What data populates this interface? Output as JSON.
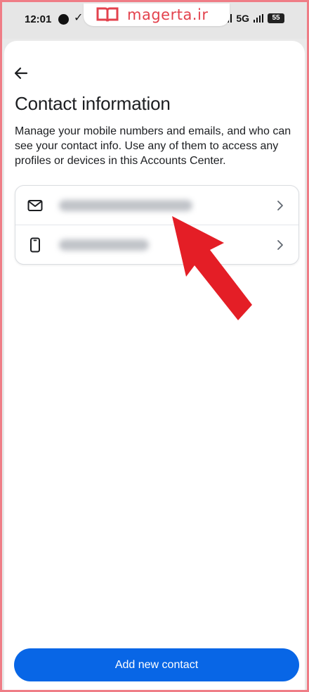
{
  "status_bar": {
    "time": "12:01",
    "network": "5G",
    "battery": "55"
  },
  "watermark": {
    "text": "magerta.ir",
    "color": "#e3424d"
  },
  "header": {
    "back_icon": "arrow-left-icon"
  },
  "page": {
    "title": "Contact information",
    "description": "Manage your mobile numbers and emails, and who can see your contact info. Use any of them to access any profiles or devices in this Accounts Center."
  },
  "contacts": [
    {
      "icon": "mail-icon",
      "value": ""
    },
    {
      "icon": "mobile-phone-icon",
      "value": ""
    }
  ],
  "footer": {
    "add_button_label": "Add new contact",
    "accent_color": "#0866e6"
  },
  "annotation": {
    "icon": "red-pointer-arrow-icon",
    "color": "#e41e26"
  }
}
